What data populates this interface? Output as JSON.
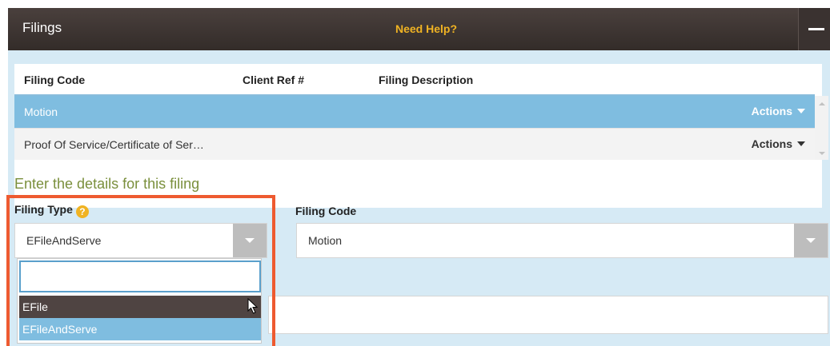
{
  "header": {
    "title": "Filings",
    "help_link": "Need Help?"
  },
  "table": {
    "columns": [
      "Filing Code",
      "Client Ref #",
      "Filing Description"
    ],
    "rows": [
      {
        "code": "Motion",
        "actions_label": "Actions",
        "selected": true
      },
      {
        "code": "Proof Of Service/Certificate of Ser…",
        "actions_label": "Actions",
        "selected": false
      }
    ]
  },
  "details": {
    "section_title": "Enter the details for this filing",
    "filing_type": {
      "label": "Filing Type",
      "help_glyph": "?",
      "value": "EFileAndServe",
      "search_value": "",
      "options": [
        "EFile",
        "EFileAndServe"
      ],
      "hovered_option": "EFile",
      "selected_option": "EFileAndServe"
    },
    "filing_code": {
      "label": "Filing Code",
      "value": "Motion"
    }
  },
  "colors": {
    "header_bg": "#3a3230",
    "help_link": "#f0b323",
    "panel_bg": "#d6eaf5",
    "selected_row": "#7fbde0",
    "section_title": "#7a8f3c",
    "highlight_box": "#ee5a30",
    "hover_option": "#4f4442"
  }
}
